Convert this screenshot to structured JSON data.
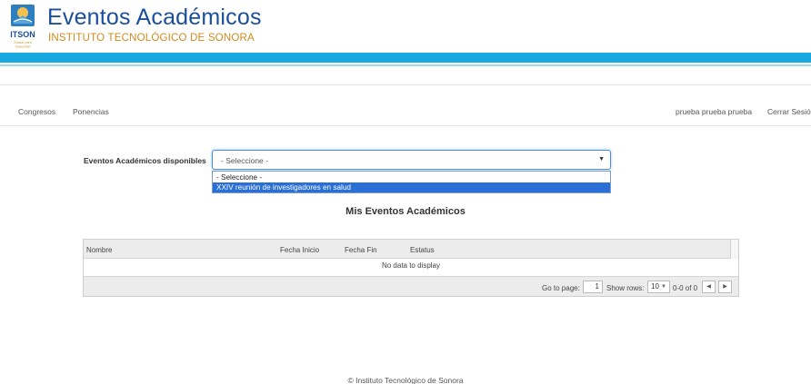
{
  "header": {
    "title": "Eventos Académicos",
    "subtitle": "INSTITUTO TECNOLÓGICO DE SONORA",
    "logo_text": "ITSON",
    "logo_tagline": "Educar para Trascender"
  },
  "nav": {
    "left": [
      "Congresos",
      "Ponencias"
    ],
    "user_name": "prueba prueba prueba",
    "logout": "Cerrar Sesión"
  },
  "events_select": {
    "label": "Eventos Académicos disponibles",
    "value": "- Seleccione -",
    "options": [
      "- Seleccione -",
      "XXIV reunión de investigadores en salud"
    ],
    "highlighted_index": 1
  },
  "my_events": {
    "title": "Mis Eventos Académicos",
    "columns": [
      "Nombre",
      "Fecha Inicio",
      "Fecha Fin",
      "Estatus"
    ],
    "empty_text": "No data to display",
    "pager": {
      "go_to_label": "Go to page:",
      "page": "1",
      "rows_label": "Show rows:",
      "rows_value": "10",
      "range": "0-0 of 0",
      "prev": "◀",
      "next": "▶"
    }
  },
  "footer": {
    "text": "© Instituto Tecnológico de Sonora"
  },
  "colors": {
    "brand_blue": "#1b4f9c",
    "brand_gold": "#d18a1c",
    "bar_blue": "#18a8e0",
    "highlight": "#2a6fd6"
  }
}
